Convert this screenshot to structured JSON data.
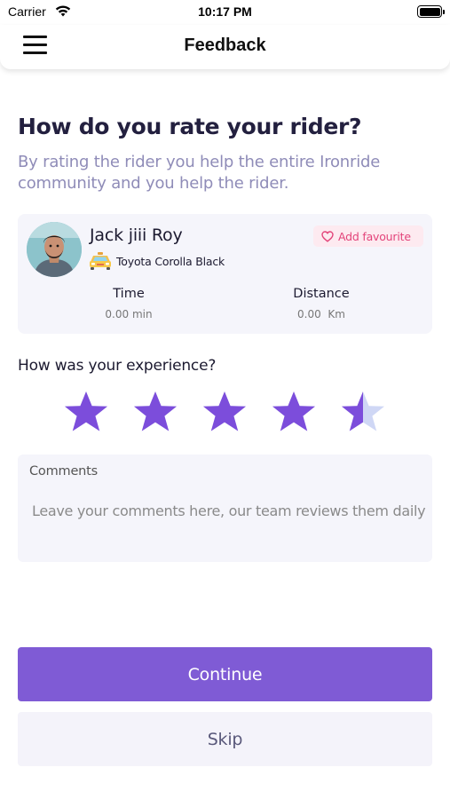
{
  "status_bar": {
    "carrier": "Carrier",
    "time": "10:17 PM"
  },
  "header": {
    "title": "Feedback",
    "menu_icon": "hamburger-menu-icon"
  },
  "intro": {
    "title": "How do you rate your rider?",
    "subtitle": "By rating the rider you help the entire Ironride community and you help the rider."
  },
  "rider": {
    "name": "Jack jiii Roy",
    "car_model": "Toyota Corolla Black",
    "car_icon": "taxi-car-icon",
    "favourite_label": "Add favourite",
    "favourite_icon": "heart-icon",
    "stats": {
      "time_label": "Time",
      "time_value": "0.00 min",
      "distance_label": "Distance",
      "distance_value": "0.00  Km"
    }
  },
  "experience": {
    "label": "How was your experience?",
    "rating": 4.5,
    "max_rating": 5
  },
  "comments": {
    "label": "Comments",
    "placeholder": "Leave your comments here, our team reviews them daily",
    "value": ""
  },
  "actions": {
    "continue_label": "Continue",
    "skip_label": "Skip"
  },
  "colors": {
    "accent": "#7f5bd5",
    "star_filled": "#7c4ddb",
    "star_empty": "#cfd7f5",
    "favourite": "#e3447a",
    "subtitle": "#8f8cb8",
    "card_background": "#f5f5fb"
  }
}
